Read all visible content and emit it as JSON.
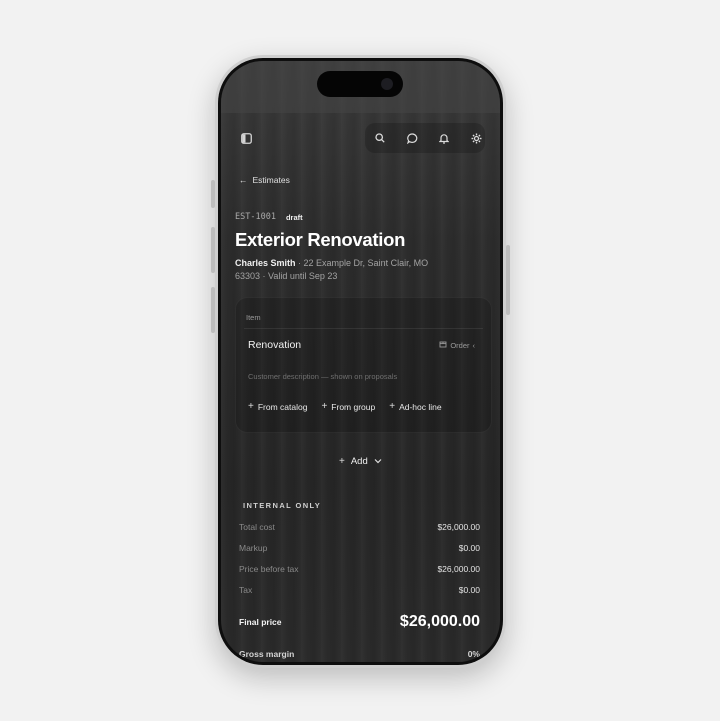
{
  "toolbar": {
    "sidebar_icon": "sidebar-icon",
    "search_icon": "search-icon",
    "messages_icon": "chat-icon",
    "notifications_icon": "bell-icon",
    "settings_icon": "gear-icon"
  },
  "nav": {
    "back_label": "Estimates"
  },
  "estimate": {
    "code": "EST-1001",
    "status": "draft",
    "title": "Exterior Renovation",
    "customer": "Charles Smith",
    "address_line": " · 22 Example Dr, Saint Clair, MO 63303 · Valid until Sep 23"
  },
  "card": {
    "column_header": "Item",
    "item_name": "Renovation",
    "order_label": "Order",
    "description_placeholder": "Customer description — shown on proposals",
    "actions": [
      {
        "label": "From catalog"
      },
      {
        "label": "From group"
      },
      {
        "label": "Ad-hoc line"
      }
    ]
  },
  "add_button": {
    "label": "Add"
  },
  "internal": {
    "heading": "INTERNAL ONLY",
    "rows": [
      {
        "label": "Total cost",
        "value": "$26,000.00"
      },
      {
        "label": "Markup",
        "value": "$0.00"
      },
      {
        "label": "Price before tax",
        "value": "$26,000.00"
      },
      {
        "label": "Tax",
        "value": "$0.00"
      }
    ],
    "final_label": "Final price",
    "final_value": "$26,000.00",
    "margin_label": "Gross margin",
    "margin_value": "0%"
  }
}
